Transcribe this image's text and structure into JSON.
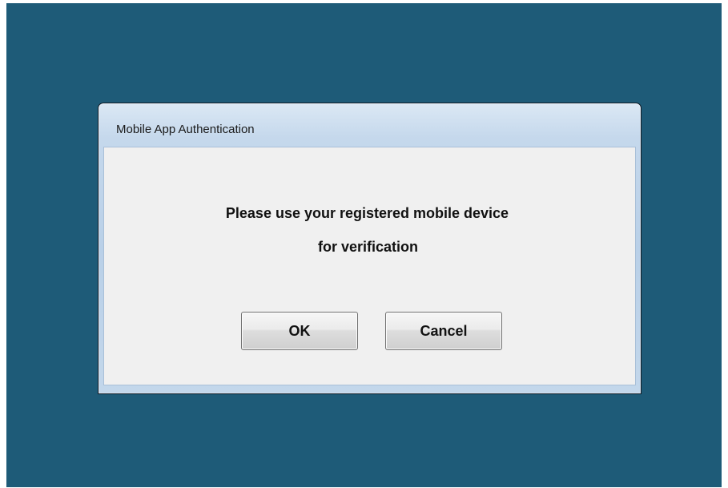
{
  "dialog": {
    "title": "Mobile App Authentication",
    "message_line1": "Please use your registered mobile device",
    "message_line2": "for verification",
    "ok_label": "OK",
    "cancel_label": "Cancel"
  },
  "colors": {
    "desktop_background": "#1e5b78",
    "dialog_frame": "#b9d0e8",
    "client_background": "#f0f0f0"
  }
}
